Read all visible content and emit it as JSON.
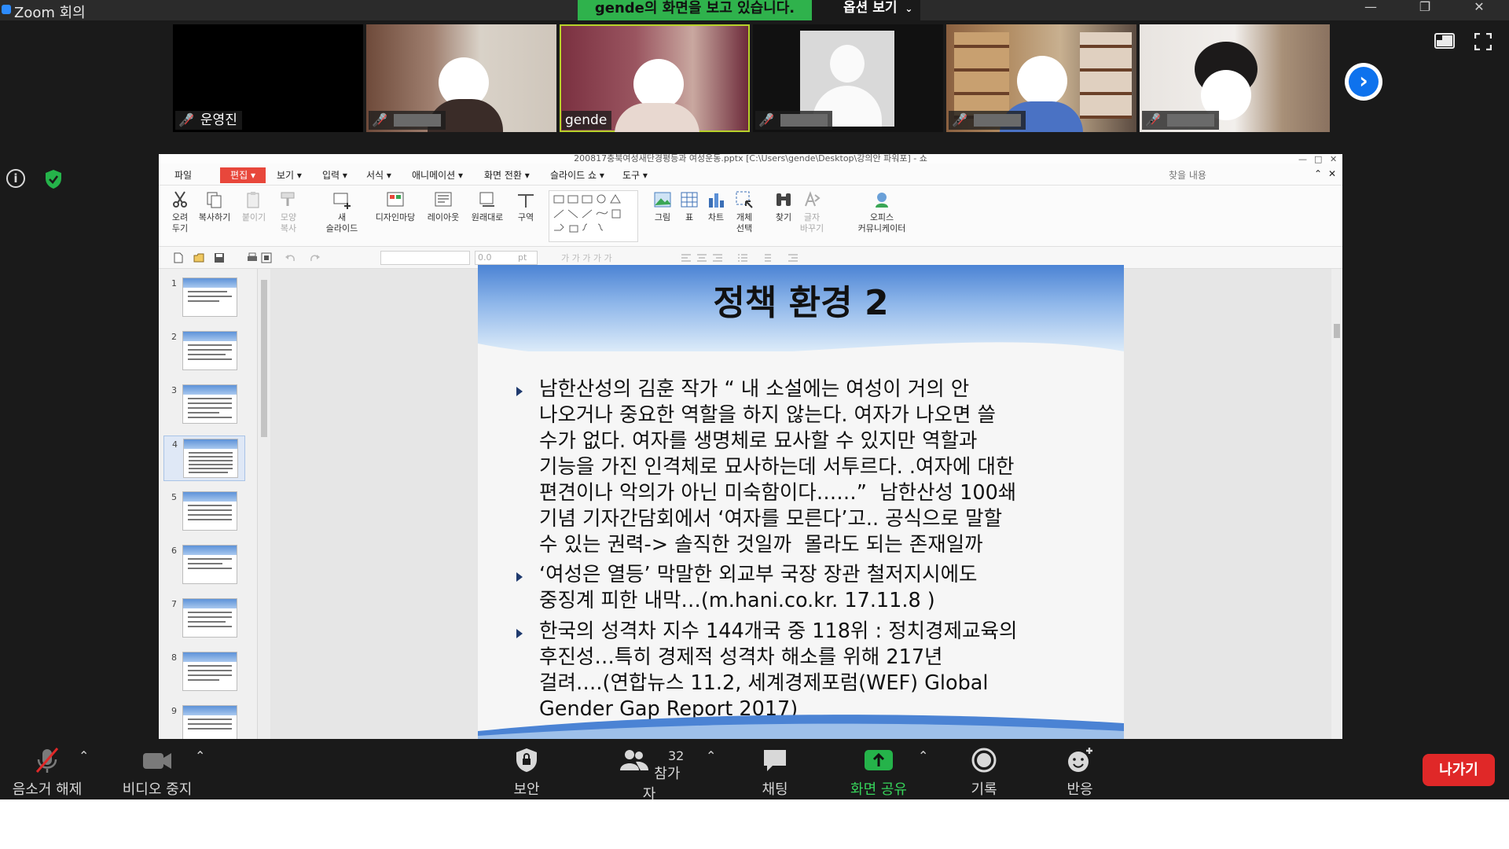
{
  "window": {
    "title": "Zoom 회의",
    "share_banner": "gende의 화면을 보고 있습니다.",
    "view_options": "옵션 보기"
  },
  "participants": [
    {
      "name": "운영진",
      "muted": true
    },
    {
      "name": "",
      "muted": true
    },
    {
      "name": "gende",
      "muted": false
    },
    {
      "name": "",
      "muted": true
    },
    {
      "name": "",
      "muted": true
    },
    {
      "name": "",
      "muted": true
    }
  ],
  "ppt": {
    "doc_title": "200817충북여성새단경평등과 여성운동.pptx [C:\\Users\\gende\\Desktop\\강의안 파워포] - 쇼",
    "menus": [
      "파일",
      "편집",
      "보기",
      "입력",
      "서식",
      "애니메이션",
      "화면 전환",
      "슬라이드 쇼",
      "도구"
    ],
    "search_placeholder": "찾을 내용",
    "ribbon": {
      "cut": "오려\n두기",
      "copy": "복사하기",
      "paste": "붙이기",
      "format_copy": "모양\n복사",
      "new_slide": "새\n슬라이드",
      "design": "디자인마당",
      "layout": "레이아웃",
      "reset": "원래대로",
      "section": "구역",
      "picture": "그림",
      "table": "표",
      "chart": "차트",
      "object_select": "개체\n선택",
      "find": "찾기",
      "replace": "글자\n바꾸기",
      "office_comm": "오피스\n커뮤니케이터"
    },
    "font_size": "0.0",
    "font_unit": "pt",
    "thumbnails": [
      "1",
      "2",
      "3",
      "4",
      "5",
      "6",
      "7",
      "8",
      "9"
    ],
    "selected_slide": 4
  },
  "slide": {
    "title": "정책 환경 2",
    "bullets": [
      "남한산성의 김훈 작가 “ 내 소설에는 여성이 거의 안\n나오거나 중요한 역할을 하지 않는다. 여자가 나오면 쓸\n수가 없다. 여자를 생명체로 묘사할 수 있지만 역할과\n기능을 가진 인격체로 묘사하는데 서투르다. .여자에 대한\n편견이나 악의가 아닌 미숙함이다……”  남한산성 100쇄\n기념 기자간담회에서 ‘여자를 모른다’고.. 공식으로 말할\n수 있는 권력-> 솔직한 것일까  몰라도 되는 존재일까",
      "‘여성은 열등’ 막말한 외교부 국장 장관 철저지시에도\n중징계 피한 내막…(m.hani.co.kr. 17.11.8 )",
      "한국의 성격차 지수 144개국 중 118위 : 정치경제교육의\n후진성…특히 경제적 성격차 해소를 위해 217년\n걸려….(연합뉴스 11.2, 세계경제포럼(WEF) Global\nGender Gap Report 2017)"
    ]
  },
  "controls": {
    "unmute": "음소거 해제",
    "stop_video": "비디오 중지",
    "security": "보안",
    "participants": "참가자",
    "participant_count": "32",
    "chat": "채팅",
    "share_screen": "화면 공유",
    "record": "기록",
    "reactions": "반응",
    "leave": "나가기"
  },
  "colors": {
    "share_green": "#2fb24c",
    "zoom_blue": "#0e72ed",
    "leave_red": "#e02828",
    "ppt_accent": "#e8473b"
  }
}
